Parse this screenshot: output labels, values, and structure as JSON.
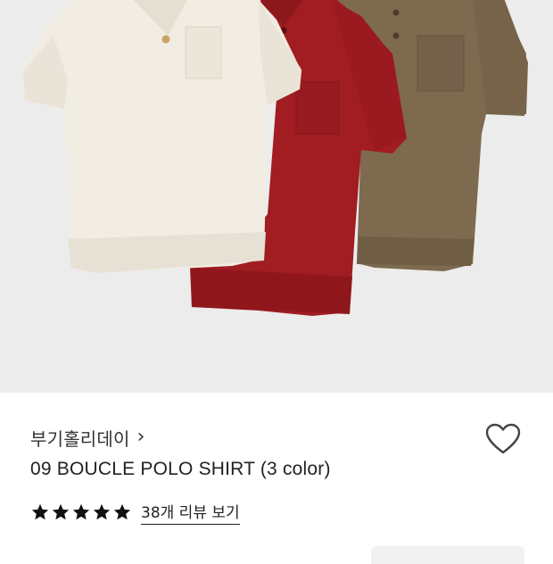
{
  "hero": {
    "image_alt": "",
    "colors": {
      "background": "#ececec",
      "cream": "#f1ede2",
      "red": "#a11d22",
      "olive": "#7e6a4f"
    }
  },
  "product": {
    "brand": "부기홀리데이",
    "brand_chevron": "›",
    "title": "09 BOUCLE POLO SHIRT (3 color)",
    "rating": {
      "stars_filled": 5,
      "stars_total": 5
    },
    "review_link": "38개 리뷰 보기"
  },
  "icons": {
    "wishlist": "heart-outline-icon",
    "star": "star-filled-icon"
  }
}
